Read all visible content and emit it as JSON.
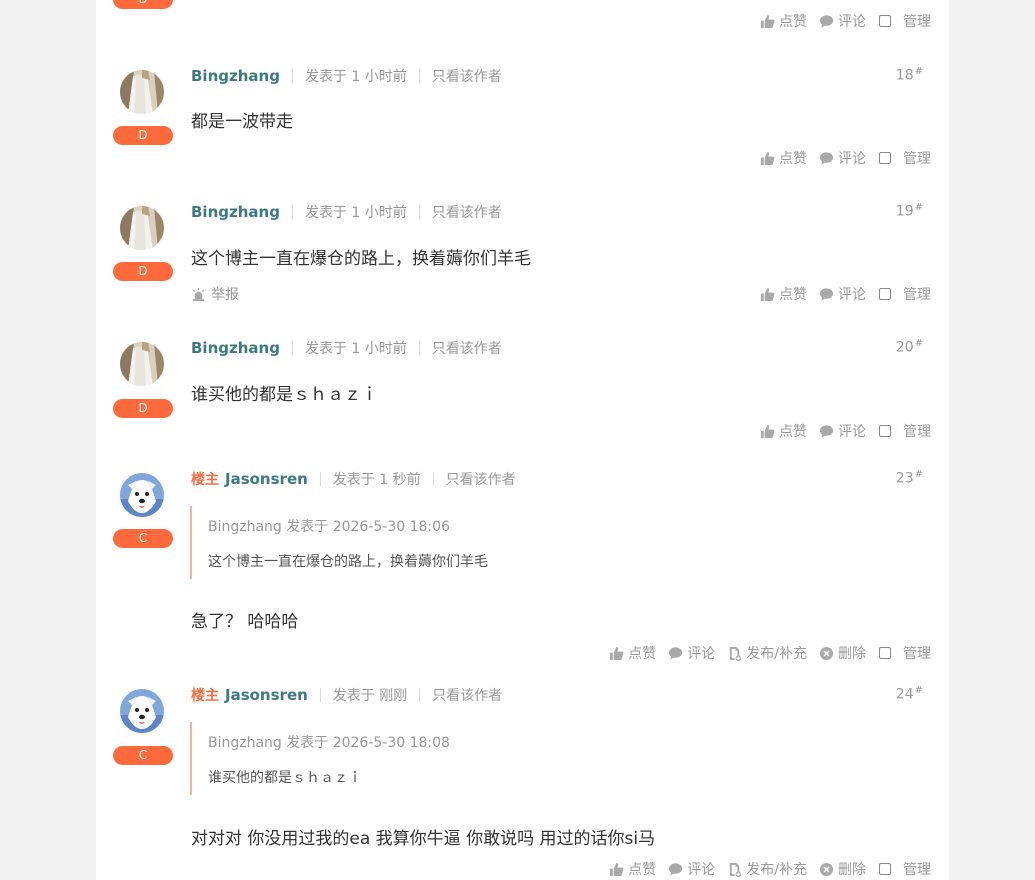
{
  "actions": {
    "like": "点赞",
    "comment": "评论",
    "manage": "管理",
    "publish": "发布/补充",
    "delete": "删除",
    "report": "举报"
  },
  "top_badge": "D",
  "posts": [
    {
      "author": "Bingzhang",
      "posted": "发表于 1 小时前",
      "only_author": "只看该作者",
      "floor": "18",
      "floor_mark": "#",
      "badge": "D",
      "content": "都是一波带走"
    },
    {
      "author": "Bingzhang",
      "posted": "发表于 1 小时前",
      "only_author": "只看该作者",
      "floor": "19",
      "floor_mark": "#",
      "badge": "D",
      "content": "这个博主一直在爆仓的路上，换着薅你们羊毛"
    },
    {
      "author": "Bingzhang",
      "posted": "发表于 1 小时前",
      "only_author": "只看该作者",
      "floor": "20",
      "floor_mark": "#",
      "badge": "D",
      "content": "谁买他的都是ｓｈａｚｉ"
    },
    {
      "owner_tag": "楼主",
      "author": "Jasonsren",
      "posted": "发表于 1 秒前",
      "only_author": "只看该作者",
      "floor": "23",
      "floor_mark": "#",
      "badge": "C",
      "quote_meta": "Bingzhang 发表于 2026-5-30 18:06",
      "quote_text": "这个博主一直在爆仓的路上，换着薅你们羊毛",
      "content": "急了？ 哈哈哈"
    },
    {
      "owner_tag": "楼主",
      "author": "Jasonsren",
      "posted": "发表于 刚刚",
      "only_author": "只看该作者",
      "floor": "24",
      "floor_mark": "#",
      "badge": "C",
      "quote_meta": "Bingzhang 发表于 2026-5-30 18:08",
      "quote_text": "谁买他的都是ｓｈａｚｉ",
      "content": "对对对 你没用过我的ea 我算你牛逼  你敢说吗 用过的话你si马"
    }
  ]
}
